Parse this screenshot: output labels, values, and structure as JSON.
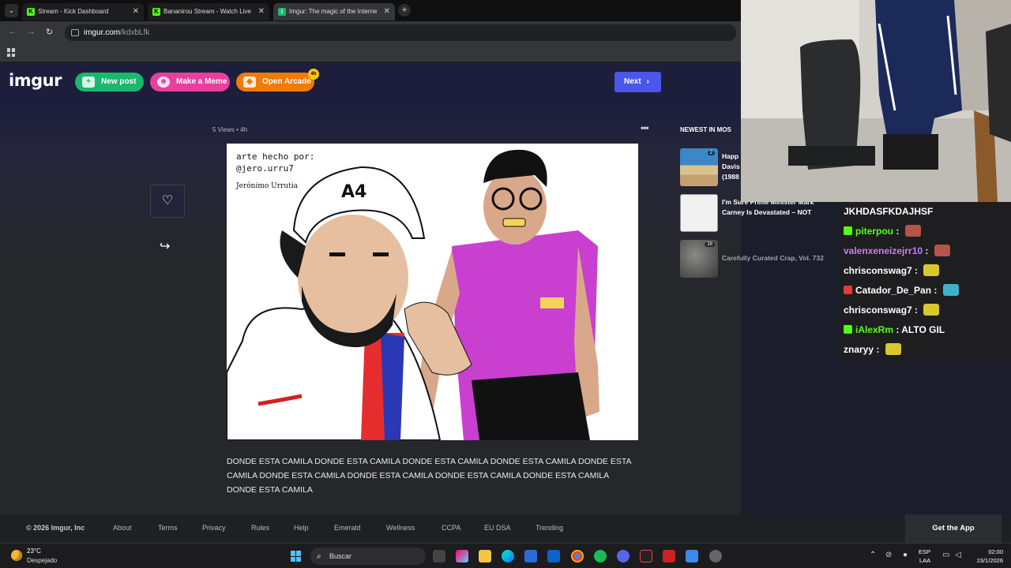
{
  "browser": {
    "tabs": [
      {
        "title": "Stream - Kick Dashboard",
        "favicon": "K"
      },
      {
        "title": "Bananirou Stream - Watch Live",
        "favicon": "K"
      },
      {
        "title": "Imgur: The magic of the Interne",
        "favicon": "i"
      }
    ],
    "url_host": "imgur.com",
    "url_path": "/kdxbLfk"
  },
  "imgur": {
    "logo": "imgur",
    "new_post": "New post",
    "make_meme": "Make a Meme",
    "open_arcade": "Open Arcade",
    "arcade_badge": "4h",
    "next": "Next"
  },
  "post": {
    "meta": "5 Views • 4h",
    "image_text": {
      "line1": "arte hecho por:",
      "line2": "@jero.urru7",
      "signature": "Jerónimo Urrutia",
      "cap_logo": "A4"
    },
    "caption": "DONDE ESTA CAMILA DONDE ESTA CAMILA DONDE ESTA CAMILA DONDE ESTA CAMILA DONDE ESTA CAMILA DONDE ESTA CAMILA DONDE ESTA CAMILA DONDE ESTA CAMILA DONDE ESTA CAMILA DONDE ESTA CAMILA"
  },
  "sidebar": {
    "title": "NEWEST IN MOS",
    "items": [
      {
        "text": "Happ Davis (1988",
        "count": "2"
      },
      {
        "text": "I'm Sure Prime Minister Mark Carney Is Devastated – NOT",
        "count": ""
      },
      {
        "text": "Carefully Curated Crap, Vol. 732",
        "count": "28"
      }
    ]
  },
  "footer": {
    "copyright": "© 2026 Imgur, Inc",
    "links": [
      "About",
      "Terms",
      "Privacy",
      "Rules",
      "Help",
      "Emerald",
      "Wellness",
      "CCPA",
      "EU DSA",
      "Trending"
    ],
    "get_app": "Get the App"
  },
  "chat": {
    "messages": [
      {
        "user": "JKHDASFKDAJHSF",
        "color": "#ffffff",
        "message": "",
        "badge": "",
        "emote": ""
      },
      {
        "user": "piterpou",
        "color": "#53fc18",
        "message": "",
        "badge": "#53fc18",
        "emote": "#b5544a"
      },
      {
        "user": "valenxeneizejrr10",
        "color": "#c77dff",
        "message": "",
        "badge": "",
        "emote": "#b5544a"
      },
      {
        "user": "chrisconswag7",
        "color": "#ffffff",
        "message": "",
        "badge": "",
        "emote": "#d9c72e"
      },
      {
        "user": "Catador_De_Pan",
        "color": "#ffffff",
        "message": "",
        "badge": "#e53935",
        "emote": "#3fb0c9"
      },
      {
        "user": "chrisconswag7",
        "color": "#ffffff",
        "message": "",
        "badge": "",
        "emote": "#d9c72e"
      },
      {
        "user": "iAlexRm",
        "color": "#53fc18",
        "message": "ALTO GIL",
        "badge": "#53fc18",
        "emote": ""
      },
      {
        "user": "znaryy",
        "color": "#ffffff",
        "message": "",
        "badge": "",
        "emote": "#d9c72e"
      }
    ]
  },
  "taskbar": {
    "temperature": "23°C",
    "condition": "Despejado",
    "search_placeholder": "Buscar",
    "lang1": "ESP",
    "lang2": "LAA",
    "time": "02:00",
    "date": "23/1/2026"
  }
}
